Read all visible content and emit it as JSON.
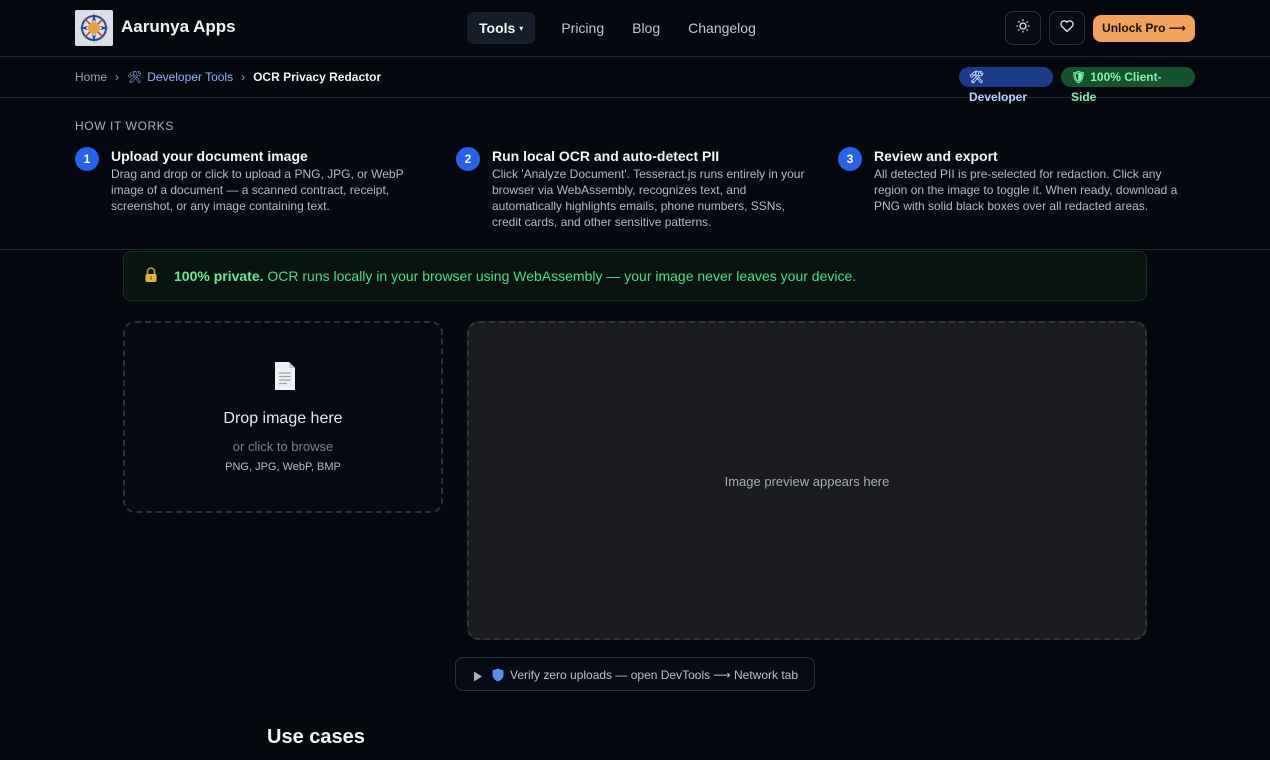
{
  "header": {
    "app_name": "Aarunya Apps",
    "nav": [
      "Tools",
      "Pricing",
      "Blog",
      "Changelog"
    ],
    "theme_icon": "sun-icon",
    "favorite_icon": "heart-icon",
    "cta": "Unlock Pro ⟶"
  },
  "breadcrumb": {
    "home": "Home",
    "section": "Developer Tools",
    "section_icon": "tools-icon",
    "current": "OCR Privacy Redactor",
    "badges": [
      "Developer",
      "100% Client-Side"
    ]
  },
  "how_it_works": {
    "title": "HOW IT WORKS",
    "steps": [
      {
        "num": "1",
        "title": "Upload your document image",
        "desc": "Drag and drop or click to upload a PNG, JPG, or WebP image of a document — a scanned contract, receipt, screenshot, or any image containing text."
      },
      {
        "num": "2",
        "title": "Run local OCR and auto-detect PII",
        "desc": "Click 'Analyze Document'. Tesseract.js runs entirely in your browser via WebAssembly, recognizes text, and automatically highlights emails, phone numbers, SSNs, credit cards, and other sensitive patterns."
      },
      {
        "num": "3",
        "title": "Review and export",
        "desc": "All detected PII is pre-selected for redaction. Click any region on the image to toggle it. When ready, download a PNG with solid black boxes over all redacted areas."
      }
    ]
  },
  "privacy_banner": {
    "strong": "100% private.",
    "text": " OCR runs locally in your browser using WebAssembly — your image never leaves your device."
  },
  "dropzone": {
    "title": "Drop image here",
    "subtitle": "or click to browse",
    "formats": "PNG, JPG, WebP, BMP"
  },
  "preview": {
    "placeholder": "Image preview appears here"
  },
  "verify": {
    "label": "Verify zero uploads — open DevTools ⟶ Network tab"
  },
  "use_cases": {
    "title": "Use cases"
  },
  "colors": {
    "accent": "#2563eb",
    "cta": "#f2a25a",
    "success": "#4ade80"
  }
}
